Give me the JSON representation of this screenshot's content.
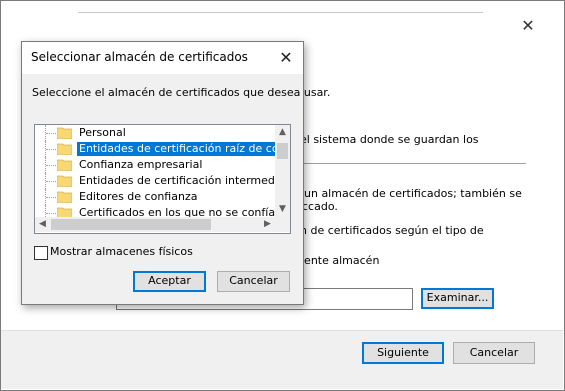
{
  "wizard": {
    "close_glyph": "✕",
    "text_lines": [
      "el sistema donde se guardan los",
      "un almacén de certificados; también se",
      "ccado.",
      "n de certificados según el tipo de",
      "iente almacén"
    ],
    "browse_label": "Examinar...",
    "next_label": "Siguiente",
    "cancel_label": "Cancelar"
  },
  "dialog": {
    "title": "Seleccionar almacén de certificados",
    "close_glyph": "✕",
    "instruction": "Seleccione el almacén de certificados que desea usar.",
    "stores": [
      {
        "label": "Personal",
        "selected": false
      },
      {
        "label": "Entidades de certificación raíz de confianza",
        "selected": true
      },
      {
        "label": "Confianza empresarial",
        "selected": false
      },
      {
        "label": "Entidades de certificación intermedias",
        "selected": false
      },
      {
        "label": "Editores de confianza",
        "selected": false
      },
      {
        "label": "Certificados en los que no se confía",
        "selected": false
      }
    ],
    "show_physical_label": "Mostrar almacenes físicos",
    "show_physical_checked": false,
    "accept_label": "Aceptar",
    "cancel_label": "Cancelar"
  },
  "colors": {
    "selection": "#0078d7",
    "folder": "#f8d775"
  }
}
